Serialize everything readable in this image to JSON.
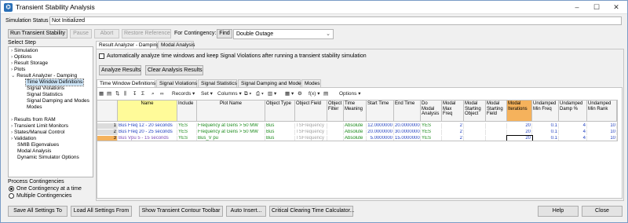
{
  "window": {
    "title": "Transient Stability Analysis",
    "minimize": "–",
    "maximize": "☐",
    "close": "✕"
  },
  "status": {
    "label": "Simulation Status",
    "value": "Not Initialized"
  },
  "toolbar": {
    "run": "Run Transient Stability",
    "pause": "Pause",
    "abort": "Abort",
    "restore": "Restore Reference",
    "contingency_label": "For Contingency:",
    "find": "Find",
    "contingency_value": "Double Outage"
  },
  "select_step": {
    "label": "Select Step",
    "items": [
      {
        "label": "Simulation",
        "exp": "›"
      },
      {
        "label": "Options",
        "exp": "›"
      },
      {
        "label": "Result Storage",
        "exp": "›"
      },
      {
        "label": "Plots",
        "exp": "›"
      },
      {
        "label": "Result Analyzer - Damping",
        "exp": "⌄"
      },
      {
        "label": "Time Window Definitions",
        "exp": ""
      },
      {
        "label": "Signal Violations",
        "exp": ""
      },
      {
        "label": "Signal Statistics",
        "exp": ""
      },
      {
        "label": "Signal Damping and Modes",
        "exp": ""
      },
      {
        "label": "Modes",
        "exp": ""
      },
      {
        "label": "Results from RAM",
        "exp": "›"
      },
      {
        "label": "Transient Limit Monitors",
        "exp": "›"
      },
      {
        "label": "States/Manual Control",
        "exp": "›"
      },
      {
        "label": "Validation",
        "exp": "›"
      },
      {
        "label": "SMIB Eigenvalues",
        "exp": ""
      },
      {
        "label": "Modal Analysis",
        "exp": ""
      },
      {
        "label": "Dynamic Simulator Options",
        "exp": ""
      }
    ]
  },
  "process": {
    "label": "Process Contingencies",
    "one": "One Contingency at a time",
    "multiple": "Multiple Contingencies"
  },
  "main_tabs": [
    "Result Analyzer - Damping",
    "Modal Analysis"
  ],
  "auto_analyze_label": "Automatically analyze time windows and keep Signal Violations after running a transient stability simulation",
  "analyze_btn": "Analyze Results",
  "clear_btn": "Clear Analysis Results",
  "sub_tabs": [
    "Time Window Definitions",
    "Signal Violations",
    "Signal Statistics",
    "Signal Damping and Modes",
    "Modes"
  ],
  "grid_toolbar": {
    "records": "Records",
    "set": "Set",
    "columns": "Columns",
    "fx": "f(x)",
    "options": "Options"
  },
  "grid": {
    "columns": [
      "Name",
      "Include",
      "Plot Name",
      "Object Type",
      "Object Field",
      "Object Filter",
      "Time Meaning",
      "Start Time",
      "End Time",
      "Do Modal Analysis",
      "Modal Max Freq",
      "Modal Starting Object",
      "Modal Starting Field",
      "Modal Iterations",
      "Undamped Min Freq",
      "Undamped Damp %",
      "Undamped Min Rank"
    ],
    "rows": [
      {
        "n": "1",
        "name": "Bus Freq 12 - 20 seconds",
        "include": "YES",
        "plot": "Frequency at Gens > 50 MW",
        "otype": "Bus",
        "ofield": "TSFrequency",
        "ofilter": "",
        "meaning": "Absolute",
        "start": "12.0000000",
        "end": "20.0000000",
        "domodal": "YES",
        "maxfreq": "2",
        "sobj": "",
        "sfield": "",
        "iter": "20",
        "minfreq": "0.1",
        "damp": "4",
        "rank": "10"
      },
      {
        "n": "2",
        "name": "Bus Freq 20 - 25 seconds",
        "include": "YES",
        "plot": "Frequency at Gens > 50 MW",
        "otype": "Bus",
        "ofield": "TSFrequency",
        "ofilter": "",
        "meaning": "Absolute",
        "start": "20.0000000",
        "end": "30.0000000",
        "domodal": "YES",
        "maxfreq": "2",
        "sobj": "",
        "sfield": "",
        "iter": "20",
        "minfreq": "0.1",
        "damp": "4",
        "rank": "10"
      },
      {
        "n": "3",
        "name": "Bus Vpu 5 - 15 seconds",
        "include": "YES",
        "plot": "Bus_V pu",
        "otype": "Bus",
        "ofield": "TSFrequency",
        "ofilter": "",
        "meaning": "Absolute",
        "start": "5.0000000",
        "end": "15.0000000",
        "domodal": "YES",
        "maxfreq": "2",
        "sobj": "",
        "sfield": "",
        "iter": "20",
        "minfreq": "0.1",
        "damp": "4",
        "rank": "10"
      }
    ]
  },
  "bottom": {
    "save": "Save All Settings To",
    "load": "Load All Settings From",
    "contour": "Show Transient Contour Toolbar",
    "auto": "Auto Insert...",
    "critical": "Critical Clearing Time Calculator...",
    "help": "Help",
    "close": "Close"
  }
}
